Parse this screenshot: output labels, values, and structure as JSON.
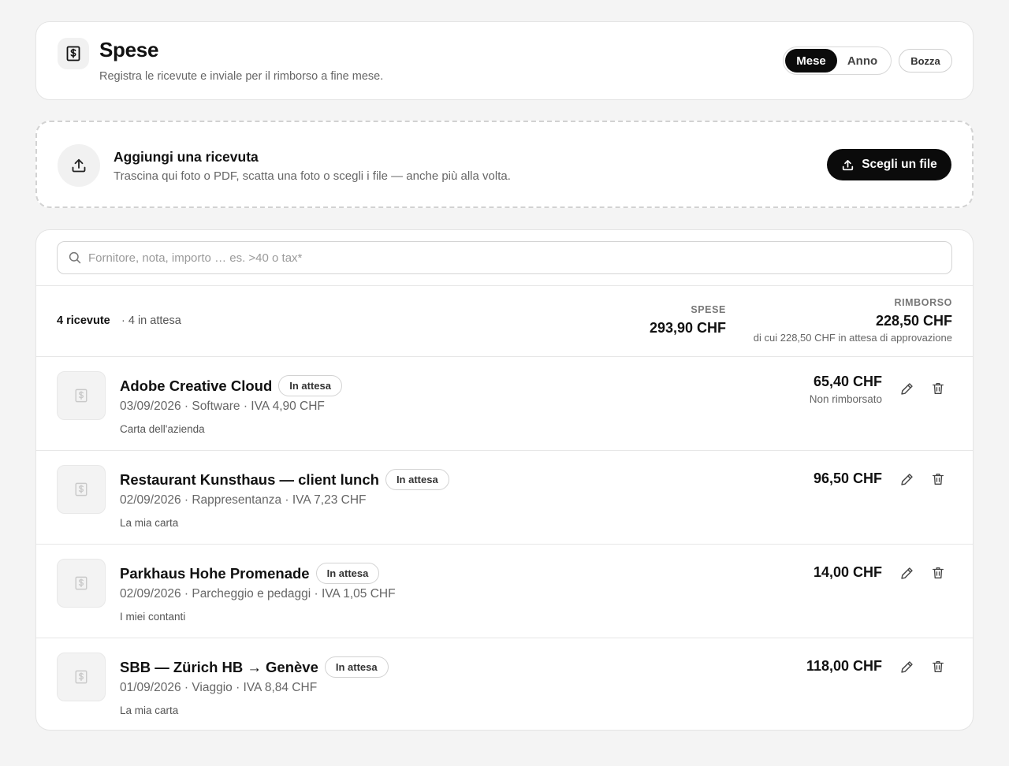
{
  "header": {
    "title": "Spese",
    "subtitle": "Registra le ricevute e inviale per il rimborso a fine mese.",
    "period_options": [
      "Mese",
      "Anno"
    ],
    "period_selected": "Mese",
    "draft_label": "Bozza"
  },
  "upload": {
    "title": "Aggiungi una ricevuta",
    "subtitle": "Trascina qui foto o PDF, scatta una foto o scegli i file — anche più alla volta.",
    "button_label": "Scegli un file"
  },
  "search": {
    "placeholder": "Fornitore, nota, importo … es. >40 o tax*"
  },
  "summary": {
    "count": "4 ricevute",
    "pending": "· 4 in attesa",
    "expenses_label": "SPESE",
    "expenses_value": "293,90 CHF",
    "refund_label": "RIMBORSO",
    "refund_value": "228,50 CHF",
    "refund_note": "di cui 228,50 CHF in attesa di approvazione"
  },
  "receipts": [
    {
      "vendor": "Adobe Creative Cloud",
      "status_badge": "In attesa",
      "meta": "03/09/2026 · Software · IVA 4,90 CHF",
      "payment": "Carta dell'azienda",
      "amount": "65,40 CHF",
      "refund_status": "Non rimborsato"
    },
    {
      "vendor": "Restaurant Kunsthaus — client lunch",
      "status_badge": "In attesa",
      "meta": "02/09/2026 · Rappresentanza · IVA 7,23 CHF",
      "payment": "La mia carta",
      "amount": "96,50 CHF",
      "refund_status": ""
    },
    {
      "vendor": "Parkhaus Hohe Promenade",
      "status_badge": "In attesa",
      "meta": "02/09/2026 · Parcheggio e pedaggi · IVA 1,05 CHF",
      "payment": "I miei contanti",
      "amount": "14,00 CHF",
      "refund_status": ""
    },
    {
      "vendor": "SBB — Zürich HB → Genève",
      "status_badge": "In attesa",
      "meta": "01/09/2026 · Viaggio · IVA 8,84 CHF",
      "payment": "La mia carta",
      "amount": "118,00 CHF",
      "refund_status": ""
    }
  ],
  "icons": {
    "app": "receipt-dollar-icon",
    "upload": "upload-icon",
    "search": "search-icon",
    "thumb": "receipt-placeholder-icon",
    "edit": "pencil-icon",
    "delete": "trash-icon"
  }
}
